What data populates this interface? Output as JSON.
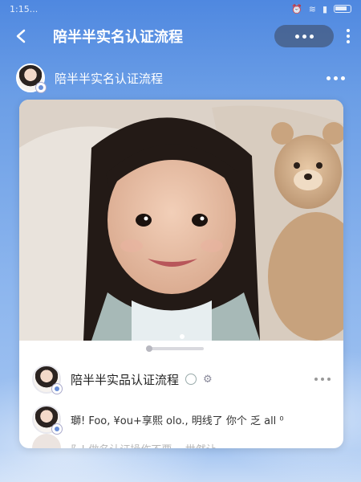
{
  "status_bar": {
    "time": "1:15...",
    "icons": [
      "alarm-icon",
      "wifi-icon",
      "signal-icon",
      "battery-icon"
    ]
  },
  "top_bar": {
    "title": "陪半半实名认证流程",
    "back_icon": "chevron-left-icon",
    "more_pill_icon": "more-horizontal-icon",
    "kebab_icon": "more-vertical-icon"
  },
  "author": {
    "name": "陪半半实名认证流程",
    "more_icon": "more-horizontal-icon"
  },
  "post": {
    "title": "陪半半实品认证流程",
    "comment": "瑡! Foo, ¥ou+享熙 olo., 明线了 你个 乏 all ⁰",
    "peek_comment": "阝! 做名认证操作不要...    世然让..."
  },
  "colors": {
    "accent": "#4f88e0",
    "card_bg": "#ffffff",
    "title_text": "#ffffff"
  }
}
